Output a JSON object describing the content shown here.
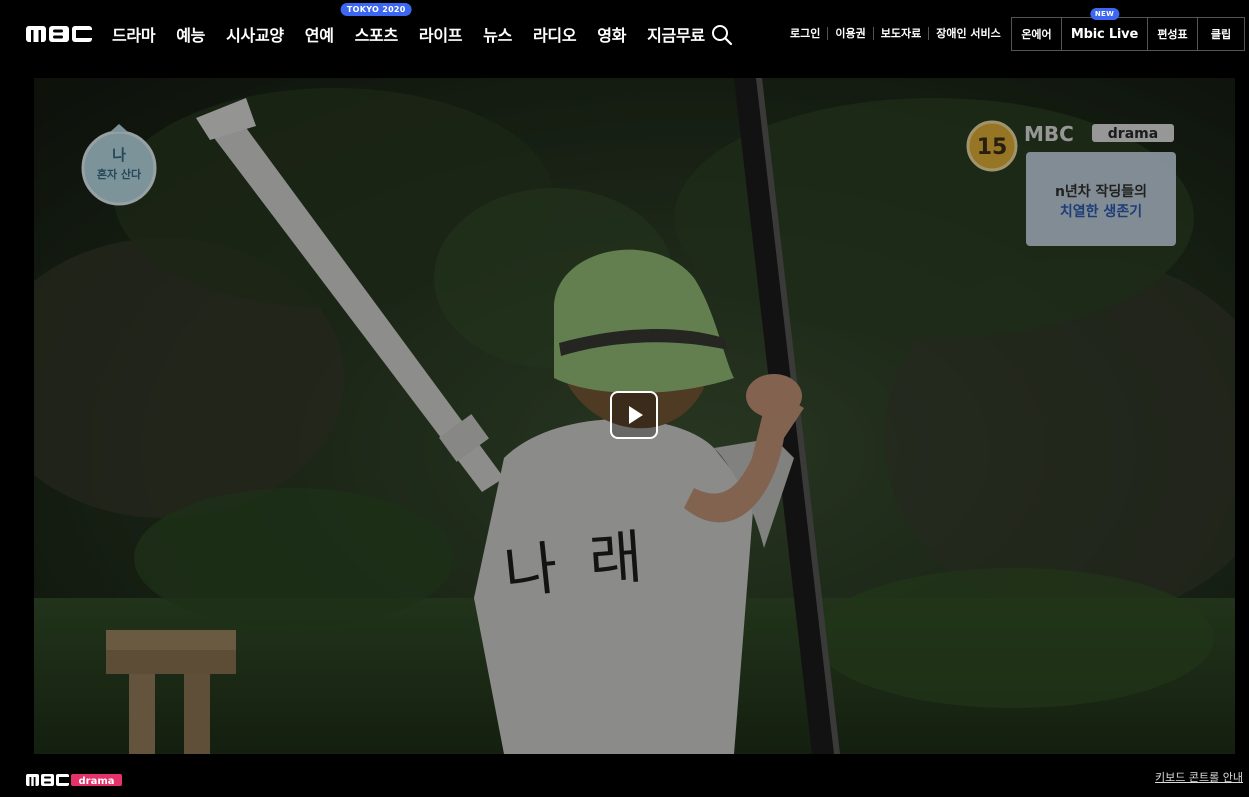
{
  "brand": {
    "logo_alt": "MBC"
  },
  "nav": {
    "items": [
      {
        "label": "드라마",
        "badge": ""
      },
      {
        "label": "예능",
        "badge": ""
      },
      {
        "label": "시사교양",
        "badge": ""
      },
      {
        "label": "연예",
        "badge": ""
      },
      {
        "label": "스포츠",
        "badge": "TOKYO 2020"
      },
      {
        "label": "라이프",
        "badge": ""
      },
      {
        "label": "뉴스",
        "badge": ""
      },
      {
        "label": "라디오",
        "badge": ""
      },
      {
        "label": "영화",
        "badge": ""
      },
      {
        "label": "지금무료",
        "badge": ""
      }
    ],
    "search_icon": "search-icon"
  },
  "util": {
    "login": "로그인",
    "pass": "이용권",
    "press": "보도자료",
    "accessibility": "장애인 서비스"
  },
  "boxes": {
    "onair": "온에어",
    "mbic_live": "Mbic Live",
    "mbic_badge": "NEW",
    "schedule": "편성표",
    "clip": "클립"
  },
  "video": {
    "program_logo_line1": "나",
    "program_logo_line2": "혼자 산다",
    "rating": "15",
    "channel_logo": "MBC drama",
    "caption_line1": "n년차 작딩들의",
    "caption_line2": "치열한 생존기",
    "shirt_text": "나 래",
    "play_icon": "play-icon"
  },
  "footer": {
    "channel_logo": "MBC drama",
    "keyboard_guide": "키보드 콘트롤 안내"
  },
  "colors": {
    "background": "#000000",
    "accent_badge": "#3c67f0",
    "caption_highlight": "#2f5fb8"
  }
}
